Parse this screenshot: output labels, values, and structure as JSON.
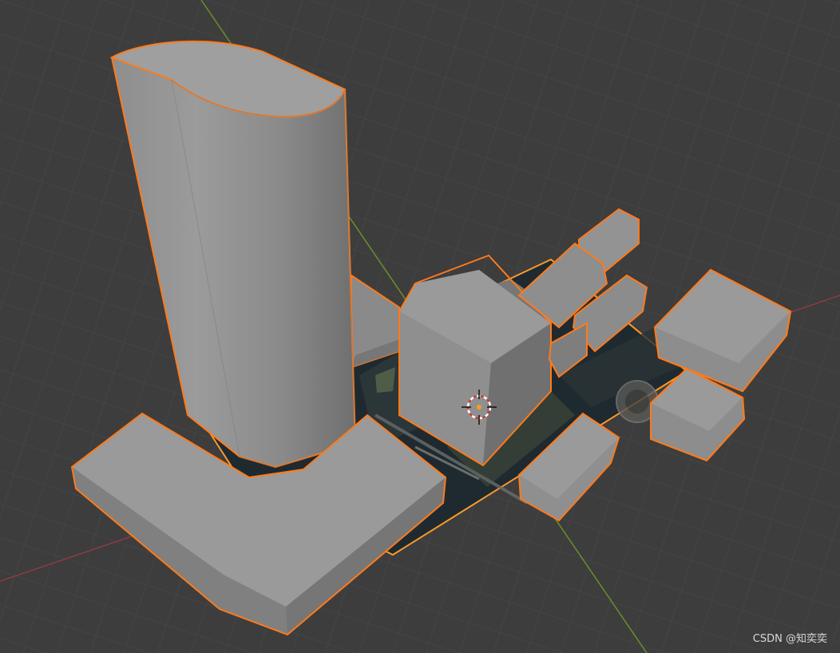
{
  "watermark": "CSDN @知奕奕",
  "colors": {
    "background": "#3d3d3d",
    "grid": "#4a4a4a",
    "x_axis": "#8c3a46",
    "y_axis": "#6a8f2a",
    "selection_outline": "#ff7a1a",
    "building_light": "#9a9a9a",
    "building_mid": "#8a8a8a",
    "building_dark": "#6e6e6e",
    "ground_photo": "#1f2a30"
  },
  "icons": {
    "cursor": "3d-cursor-icon"
  }
}
